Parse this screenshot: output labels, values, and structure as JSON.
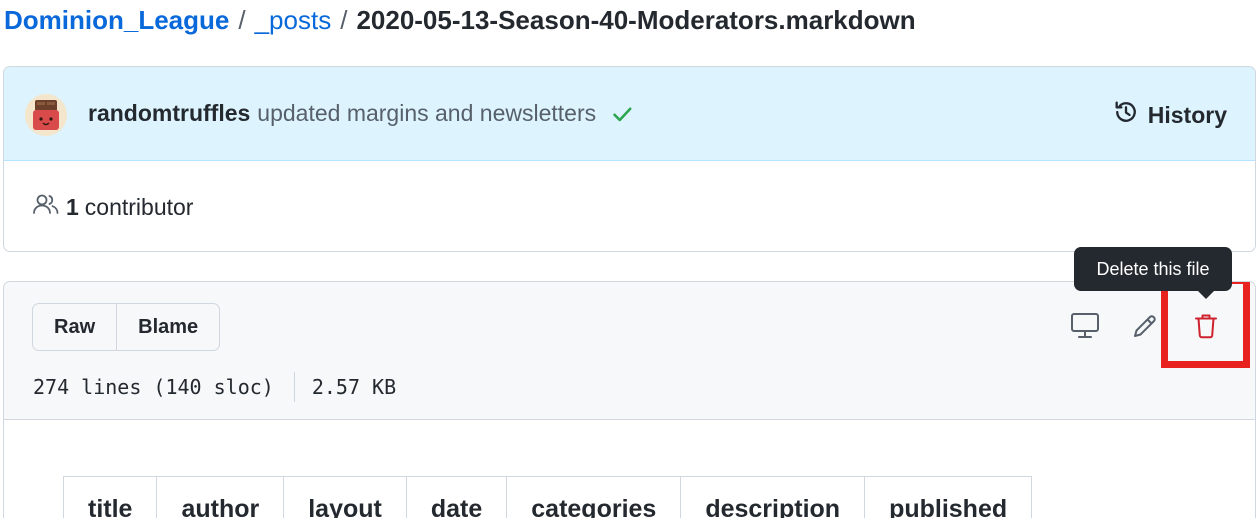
{
  "breadcrumb": {
    "repo": "Dominion_League",
    "separator": "/",
    "folder": "_posts",
    "file": "2020-05-13-Season-40-Moderators.markdown"
  },
  "commit": {
    "author": "randomtruffles",
    "message": "updated margins and newsletters",
    "history_label": "History"
  },
  "contributors": {
    "count": "1",
    "label": "contributor"
  },
  "file": {
    "raw_label": "Raw",
    "blame_label": "Blame",
    "lines": "274 lines (140 sloc)",
    "size": "2.57 KB",
    "tooltip": "Delete this file"
  },
  "table": {
    "headers": [
      "title",
      "author",
      "layout",
      "date",
      "categories",
      "description",
      "published"
    ]
  },
  "colors": {
    "link": "#0969da",
    "danger": "#cf222e",
    "success": "#2da44e",
    "highlight": "#e8231f"
  },
  "icons": [
    "check-icon",
    "history-icon",
    "people-icon",
    "desktop-icon",
    "pencil-icon",
    "trash-icon"
  ]
}
